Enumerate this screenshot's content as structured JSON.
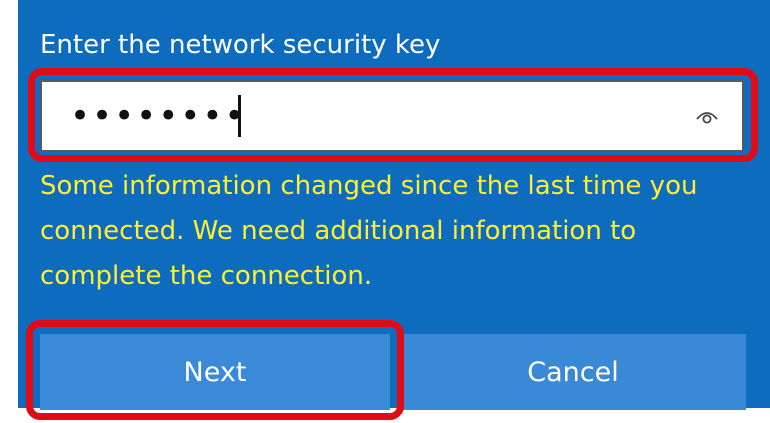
{
  "dialog": {
    "prompt": "Enter the network security key",
    "password": {
      "masked_value": "••••••••"
    },
    "message": "Some information changed since the last time you connected. We need additional information to complete the connection.",
    "buttons": {
      "next_label": "Next",
      "cancel_label": "Cancel"
    }
  },
  "icons": {
    "reveal": "eye-icon"
  },
  "colors": {
    "panel": "#0e6cbf",
    "message_text": "#ffee33",
    "button": "#3b8ad8",
    "highlight": "#e10b17"
  }
}
